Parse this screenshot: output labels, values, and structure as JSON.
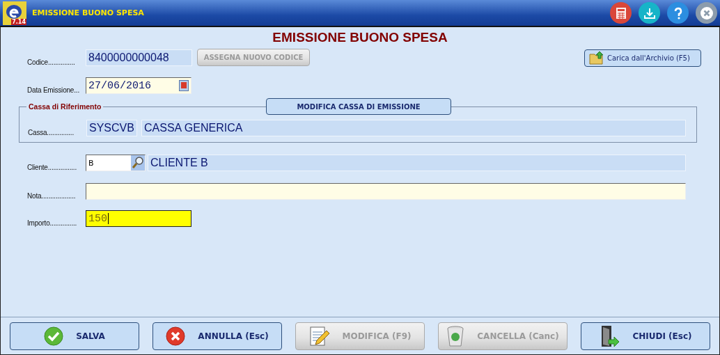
{
  "window": {
    "title": "EMISSIONE BUONO SPESA",
    "logo_badge": "7.14"
  },
  "heading": "EMISSIONE BUONO SPESA",
  "codice": {
    "label": "Codice...............",
    "value": "8400000000048",
    "button": {
      "label": "ASSEGNA NUOVO CODICE",
      "disabled": true
    }
  },
  "archive_button": {
    "label": "Carica dall'Archivio (F5)",
    "disabled": false
  },
  "data_emissione": {
    "label": "Data Emissione...",
    "value": "27/06/2016"
  },
  "cassa_group": {
    "legend": "Cassa di Riferimento",
    "button": {
      "label": "MODIFICA CASSA DI EMISSIONE",
      "disabled": false
    },
    "label": "Cassa...............",
    "code": "SYSCVB",
    "name": "CASSA GENERICA"
  },
  "cliente": {
    "label": "Cliente................",
    "code": "B",
    "name": "CLIENTE B"
  },
  "nota": {
    "label": "Nota..................."
  },
  "importo": {
    "label": "Importo...............",
    "value": "150"
  },
  "footer_buttons": [
    {
      "kind": "save",
      "label": "SALVA",
      "disabled": false
    },
    {
      "kind": "cancel",
      "label": "ANNULLA (Esc)",
      "disabled": false
    },
    {
      "kind": "edit",
      "label": "MODIFICA  (F9)",
      "disabled": true
    },
    {
      "kind": "delete",
      "label": "CANCELLA  (Canc)",
      "disabled": true
    },
    {
      "kind": "close",
      "label": "CHIUDI  (Esc)",
      "disabled": false
    }
  ]
}
